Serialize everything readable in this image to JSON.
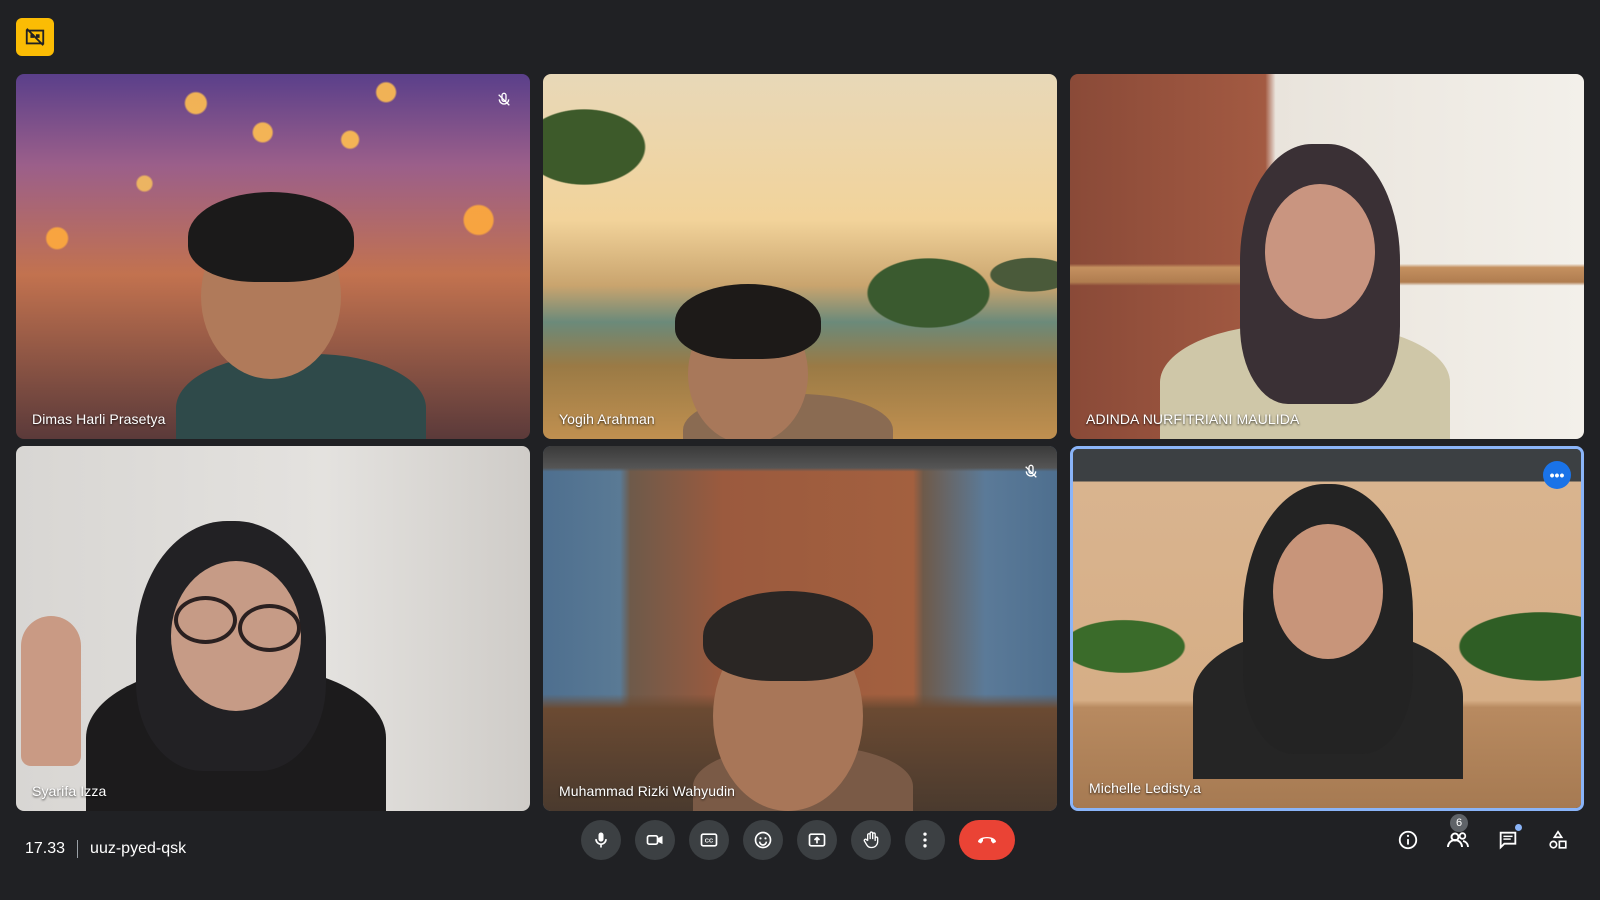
{
  "top_badge": {
    "icon": "tiles-hidden-icon"
  },
  "participants": [
    {
      "name": "Dimas Harli Prasetya",
      "muted": true,
      "background": "night-market-lanterns"
    },
    {
      "name": "Yogih Arahman",
      "muted": false,
      "background": "desert-oasis"
    },
    {
      "name": "ADINDA NURFITRIANI MAULIDA",
      "muted": false,
      "background": "cafe-interior"
    },
    {
      "name": "Syarifa Izza",
      "muted": false,
      "background": "plain-wall"
    },
    {
      "name": "Muhammad Rizki Wahyudin",
      "muted": true,
      "background": "loft-office"
    },
    {
      "name": "Michelle Ledisty.a",
      "muted": false,
      "background": "living-room",
      "active_speaker": true
    }
  ],
  "meeting": {
    "time": "17.33",
    "code": "uuz-pyed-qsk"
  },
  "controls": [
    "microphone-icon",
    "camera-icon",
    "captions-icon",
    "emoji-icon",
    "present-icon",
    "raise-hand-icon",
    "more-options-icon",
    "hang-up-icon"
  ],
  "right_controls": {
    "people_count": "6",
    "icons": [
      "info-icon",
      "people-icon",
      "chat-icon",
      "activities-icon"
    ]
  },
  "colors": {
    "background": "#202124",
    "hangup": "#ea4335",
    "active_border": "#8ab4f8",
    "badge": "#fbbc04"
  }
}
